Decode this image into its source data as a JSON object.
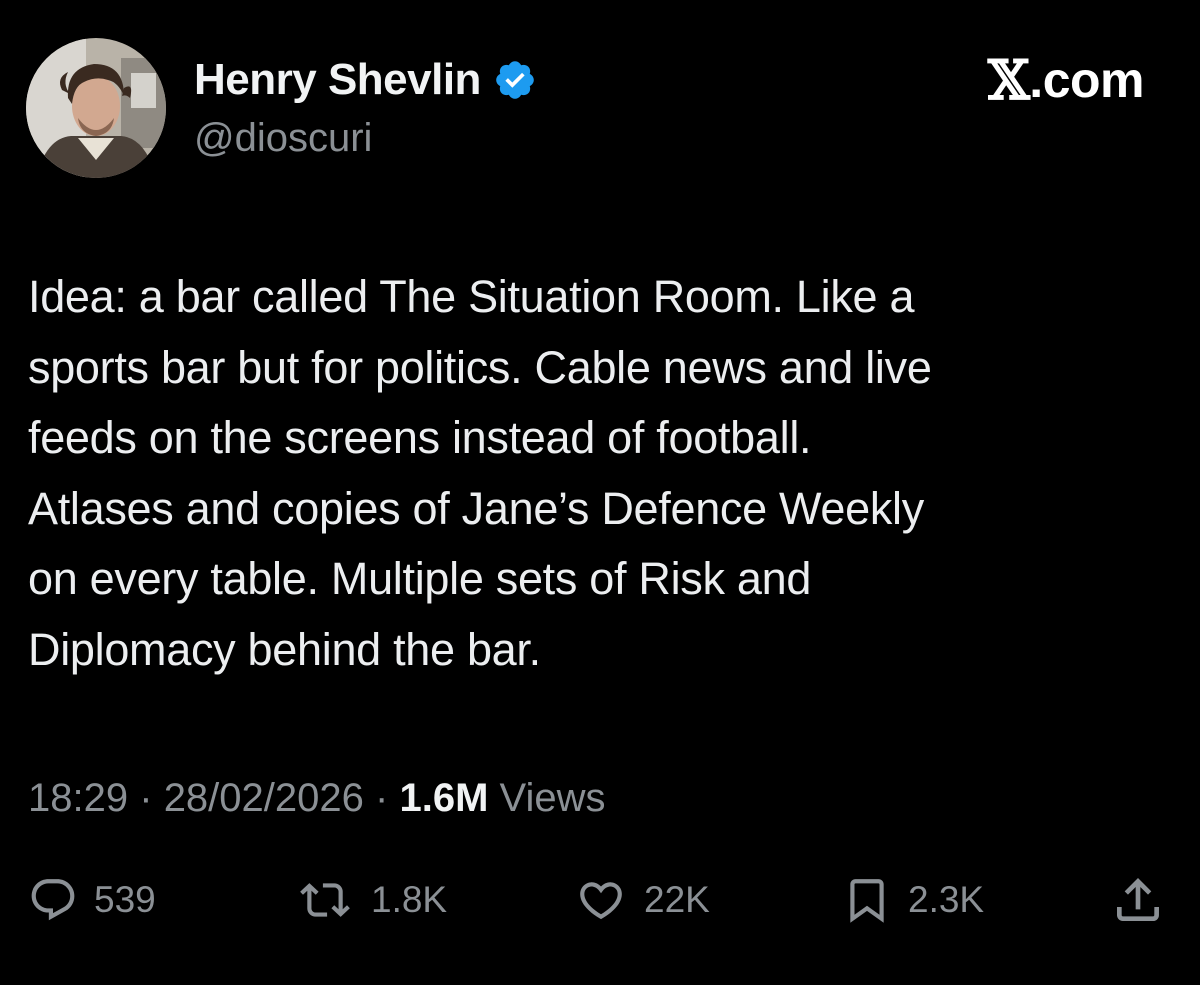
{
  "author": {
    "display_name": "Henry Shevlin",
    "handle": "@dioscuri",
    "verified": true,
    "avatar_icon": "profile-photo"
  },
  "brand": {
    "x_glyph": "𝕏",
    "suffix": ".com"
  },
  "post": {
    "lines": [
      "Idea: a bar called The Situation Room. Like a",
      "sports bar but for politics. Cable news and live",
      "feeds on the screens instead of football.",
      "Atlases and copies of Jane’s Defence Weekly",
      "on every table. Multiple sets of Risk and",
      "Diplomacy behind the bar."
    ]
  },
  "meta": {
    "time": "18:29",
    "separator": "·",
    "date": "28/02/2026",
    "views_count": "1.6M",
    "views_label": "Views"
  },
  "actions": {
    "replies": "539",
    "reposts": "1.8K",
    "likes": "22K",
    "bookmarks": "2.3K"
  },
  "colors": {
    "background": "#000000",
    "text_primary": "#e7e9ea",
    "text_secondary": "#8b9095",
    "verified_blue": "#1d9bf0"
  }
}
